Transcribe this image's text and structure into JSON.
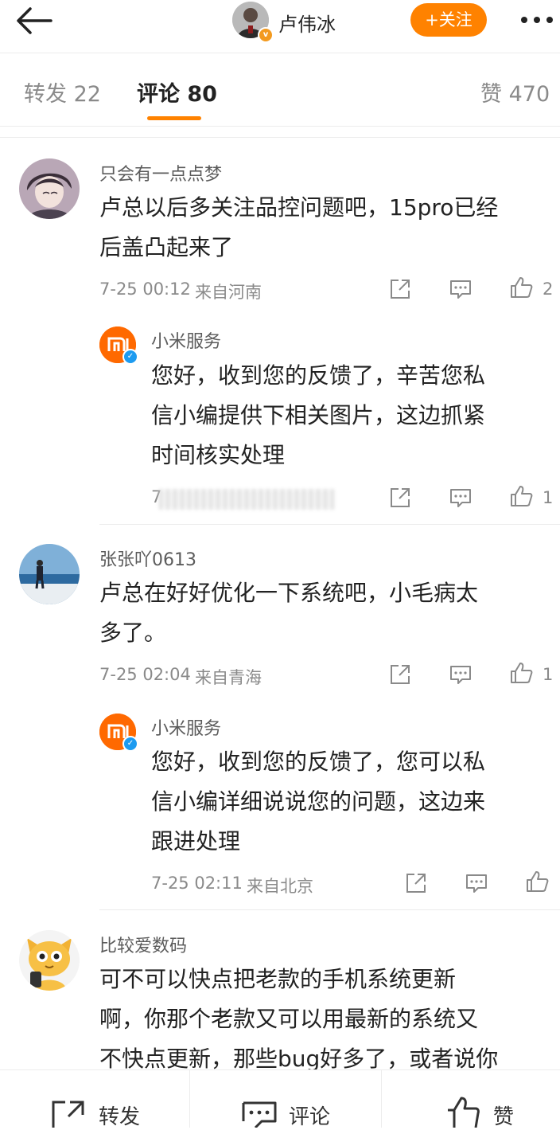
{
  "header": {
    "author_name": "卢伟冰",
    "follow_label": "+关注",
    "icons": [
      "back-arrow-icon",
      "more-icon"
    ]
  },
  "tabs": [
    {
      "label": "转发 22"
    },
    {
      "label": "评论 80",
      "active": true
    },
    {
      "label": "赞 470"
    }
  ],
  "comments": [
    {
      "user": "只会有一点点梦",
      "text": [
        "卢总以后多关注品控问题吧，15pro已经",
        "后盖凸起来了"
      ],
      "time": "7-25 00:12",
      "location": "来自河南",
      "likes": "2",
      "reply": {
        "user": "小米服务",
        "text": [
          "您好，收到您的反馈了，辛苦您私",
          "信小编提供下相关图片，这边抓紧",
          "时间核实处理"
        ],
        "time_partial": "7",
        "likes": "1"
      }
    },
    {
      "user": "张张吖0613",
      "text": [
        "卢总在好好优化一下系统吧，小毛病太",
        "多了。"
      ],
      "time": "7-25 02:04",
      "location": "来自青海",
      "likes": "1",
      "reply": {
        "user": "小米服务",
        "text": [
          "您好，收到您的反馈了，您可以私",
          "信小编详细说说您的问题，这边来",
          "跟进处理"
        ],
        "time": "7-25 02:11",
        "location": "来自北京",
        "likes": ""
      }
    },
    {
      "user": "比较爱数码",
      "text": [
        "可不可以快点把老款的手机系统更新",
        "啊，你那个老款又可以用最新的系统又",
        "不快点更新，那些bug好多了，或者说你"
      ]
    }
  ],
  "bottom_bar": {
    "repost_label": "转发",
    "comment_label": "评论",
    "like_label": "赞"
  },
  "colors": {
    "accent": "#ff8200",
    "xiaomi": "#ff6900",
    "text": "#222222",
    "muted": "#8a8a8a"
  }
}
